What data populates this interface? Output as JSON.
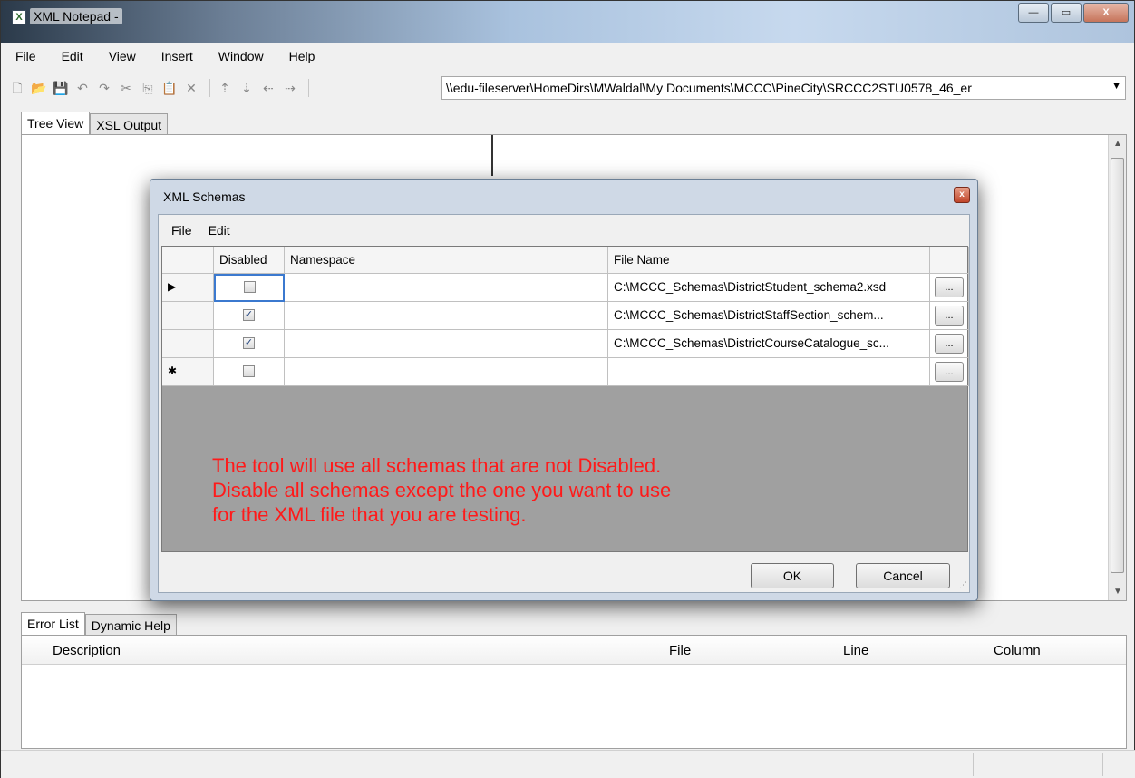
{
  "window": {
    "title": "XML Notepad -",
    "app_icon": "X",
    "minimize": "—",
    "maximize": "▭",
    "close": "X"
  },
  "menu": {
    "items": [
      "File",
      "Edit",
      "View",
      "Insert",
      "Window",
      "Help"
    ]
  },
  "toolbar": {
    "path": "\\\\edu-fileserver\\HomeDirs\\MWaldal\\My Documents\\MCCC\\PineCity\\SRCCC2STU0578_46_er"
  },
  "tabs_top": [
    "Tree View",
    "XSL Output"
  ],
  "tabs_bottom": [
    "Error List",
    "Dynamic Help"
  ],
  "error_list": {
    "columns": [
      "Description",
      "File",
      "Line",
      "Column"
    ]
  },
  "dialog": {
    "title": "XML Schemas",
    "close_glyph": "x",
    "menu": [
      "File",
      "Edit"
    ],
    "columns": [
      "Disabled",
      "Namespace",
      "File Name"
    ],
    "rows": [
      {
        "indicator": "▶",
        "disabled": false,
        "namespace": "",
        "file_name": "C:\\MCCC_Schemas\\DistrictStudent_schema2.xsd"
      },
      {
        "indicator": "",
        "disabled": true,
        "namespace": "",
        "file_name": "C:\\MCCC_Schemas\\DistrictStaffSection_schem..."
      },
      {
        "indicator": "",
        "disabled": true,
        "namespace": "",
        "file_name": "C:\\MCCC_Schemas\\DistrictCourseCatalogue_sc..."
      },
      {
        "indicator": "✱",
        "disabled": false,
        "namespace": "",
        "file_name": ""
      }
    ],
    "browse_label": "...",
    "note": [
      "The tool will use all schemas that are not Disabled.",
      "Disable all schemas except the one you want to use",
      "for the XML file that you are testing."
    ],
    "ok_label": "OK",
    "cancel_label": "Cancel"
  }
}
